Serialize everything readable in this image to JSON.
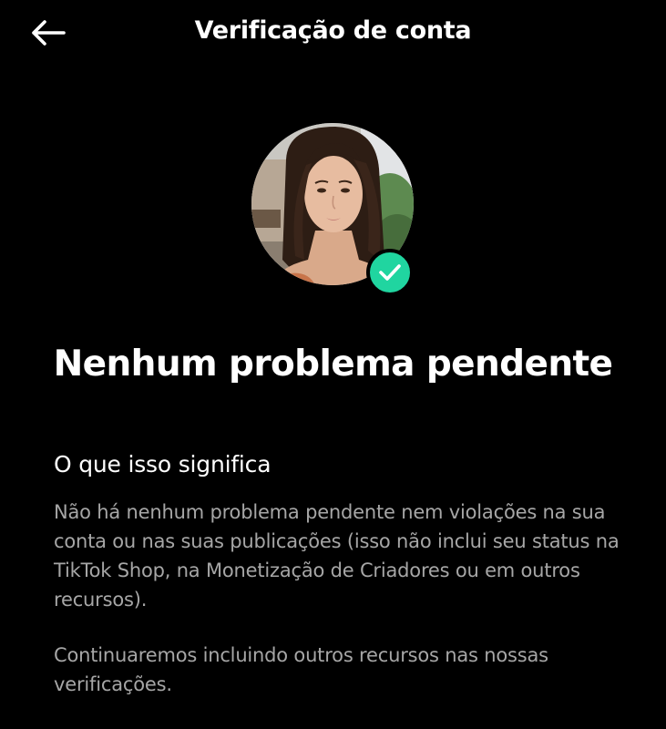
{
  "header": {
    "title": "Verificação de conta",
    "back_icon": "arrow-left-icon"
  },
  "profile": {
    "avatar_icon": "profile-photo",
    "badge_icon": "checkmark-icon",
    "badge_color": "#20d5a0"
  },
  "status": {
    "heading": "Nenhum problema pendente"
  },
  "explanation": {
    "title": "O que isso significa",
    "paragraph_1": "Não há nenhum problema pendente nem violações na sua conta ou nas suas publicações (isso não inclui seu status na TikTok Shop, na Monetização de Criadores ou em outros recursos).",
    "paragraph_2": "Continuaremos incluindo outros recursos nas nossas verificações."
  },
  "colors": {
    "background": "#000000",
    "primary_text": "#ffffff",
    "secondary_text": "#a6a6a6",
    "accent": "#20d5a0"
  }
}
